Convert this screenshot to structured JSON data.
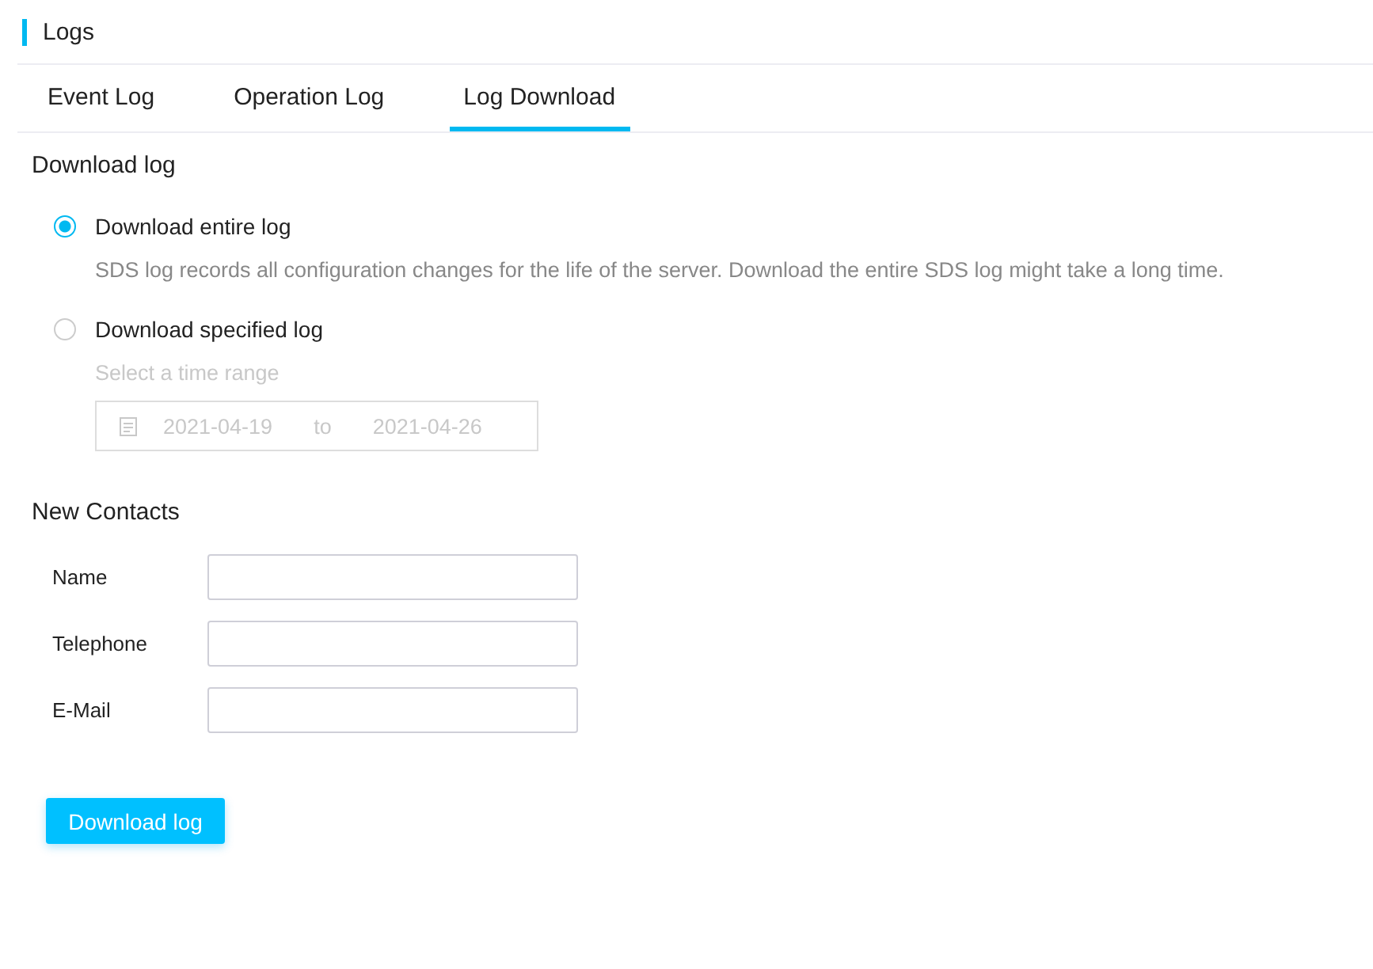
{
  "header": {
    "title": "Logs"
  },
  "tabs": [
    {
      "label": "Event Log",
      "selected": false
    },
    {
      "label": "Operation Log",
      "selected": false
    },
    {
      "label": "Log Download",
      "selected": true
    }
  ],
  "download_section": {
    "title": "Download log",
    "options": [
      {
        "label": "Download entire log",
        "selected": true,
        "description": "SDS log records all configuration changes for the life of the server. Download the entire SDS log might take a long time."
      },
      {
        "label": "Download specified log",
        "selected": false,
        "hint": "Select a time range",
        "date_range": {
          "start": "2021-04-19",
          "separator": "to",
          "end": "2021-04-26",
          "disabled": true
        }
      }
    ]
  },
  "contacts_section": {
    "title": "New Contacts",
    "fields": [
      {
        "label": "Name"
      },
      {
        "label": "Telephone"
      },
      {
        "label": "E-Mail"
      }
    ]
  },
  "button": {
    "label": "Download log"
  }
}
